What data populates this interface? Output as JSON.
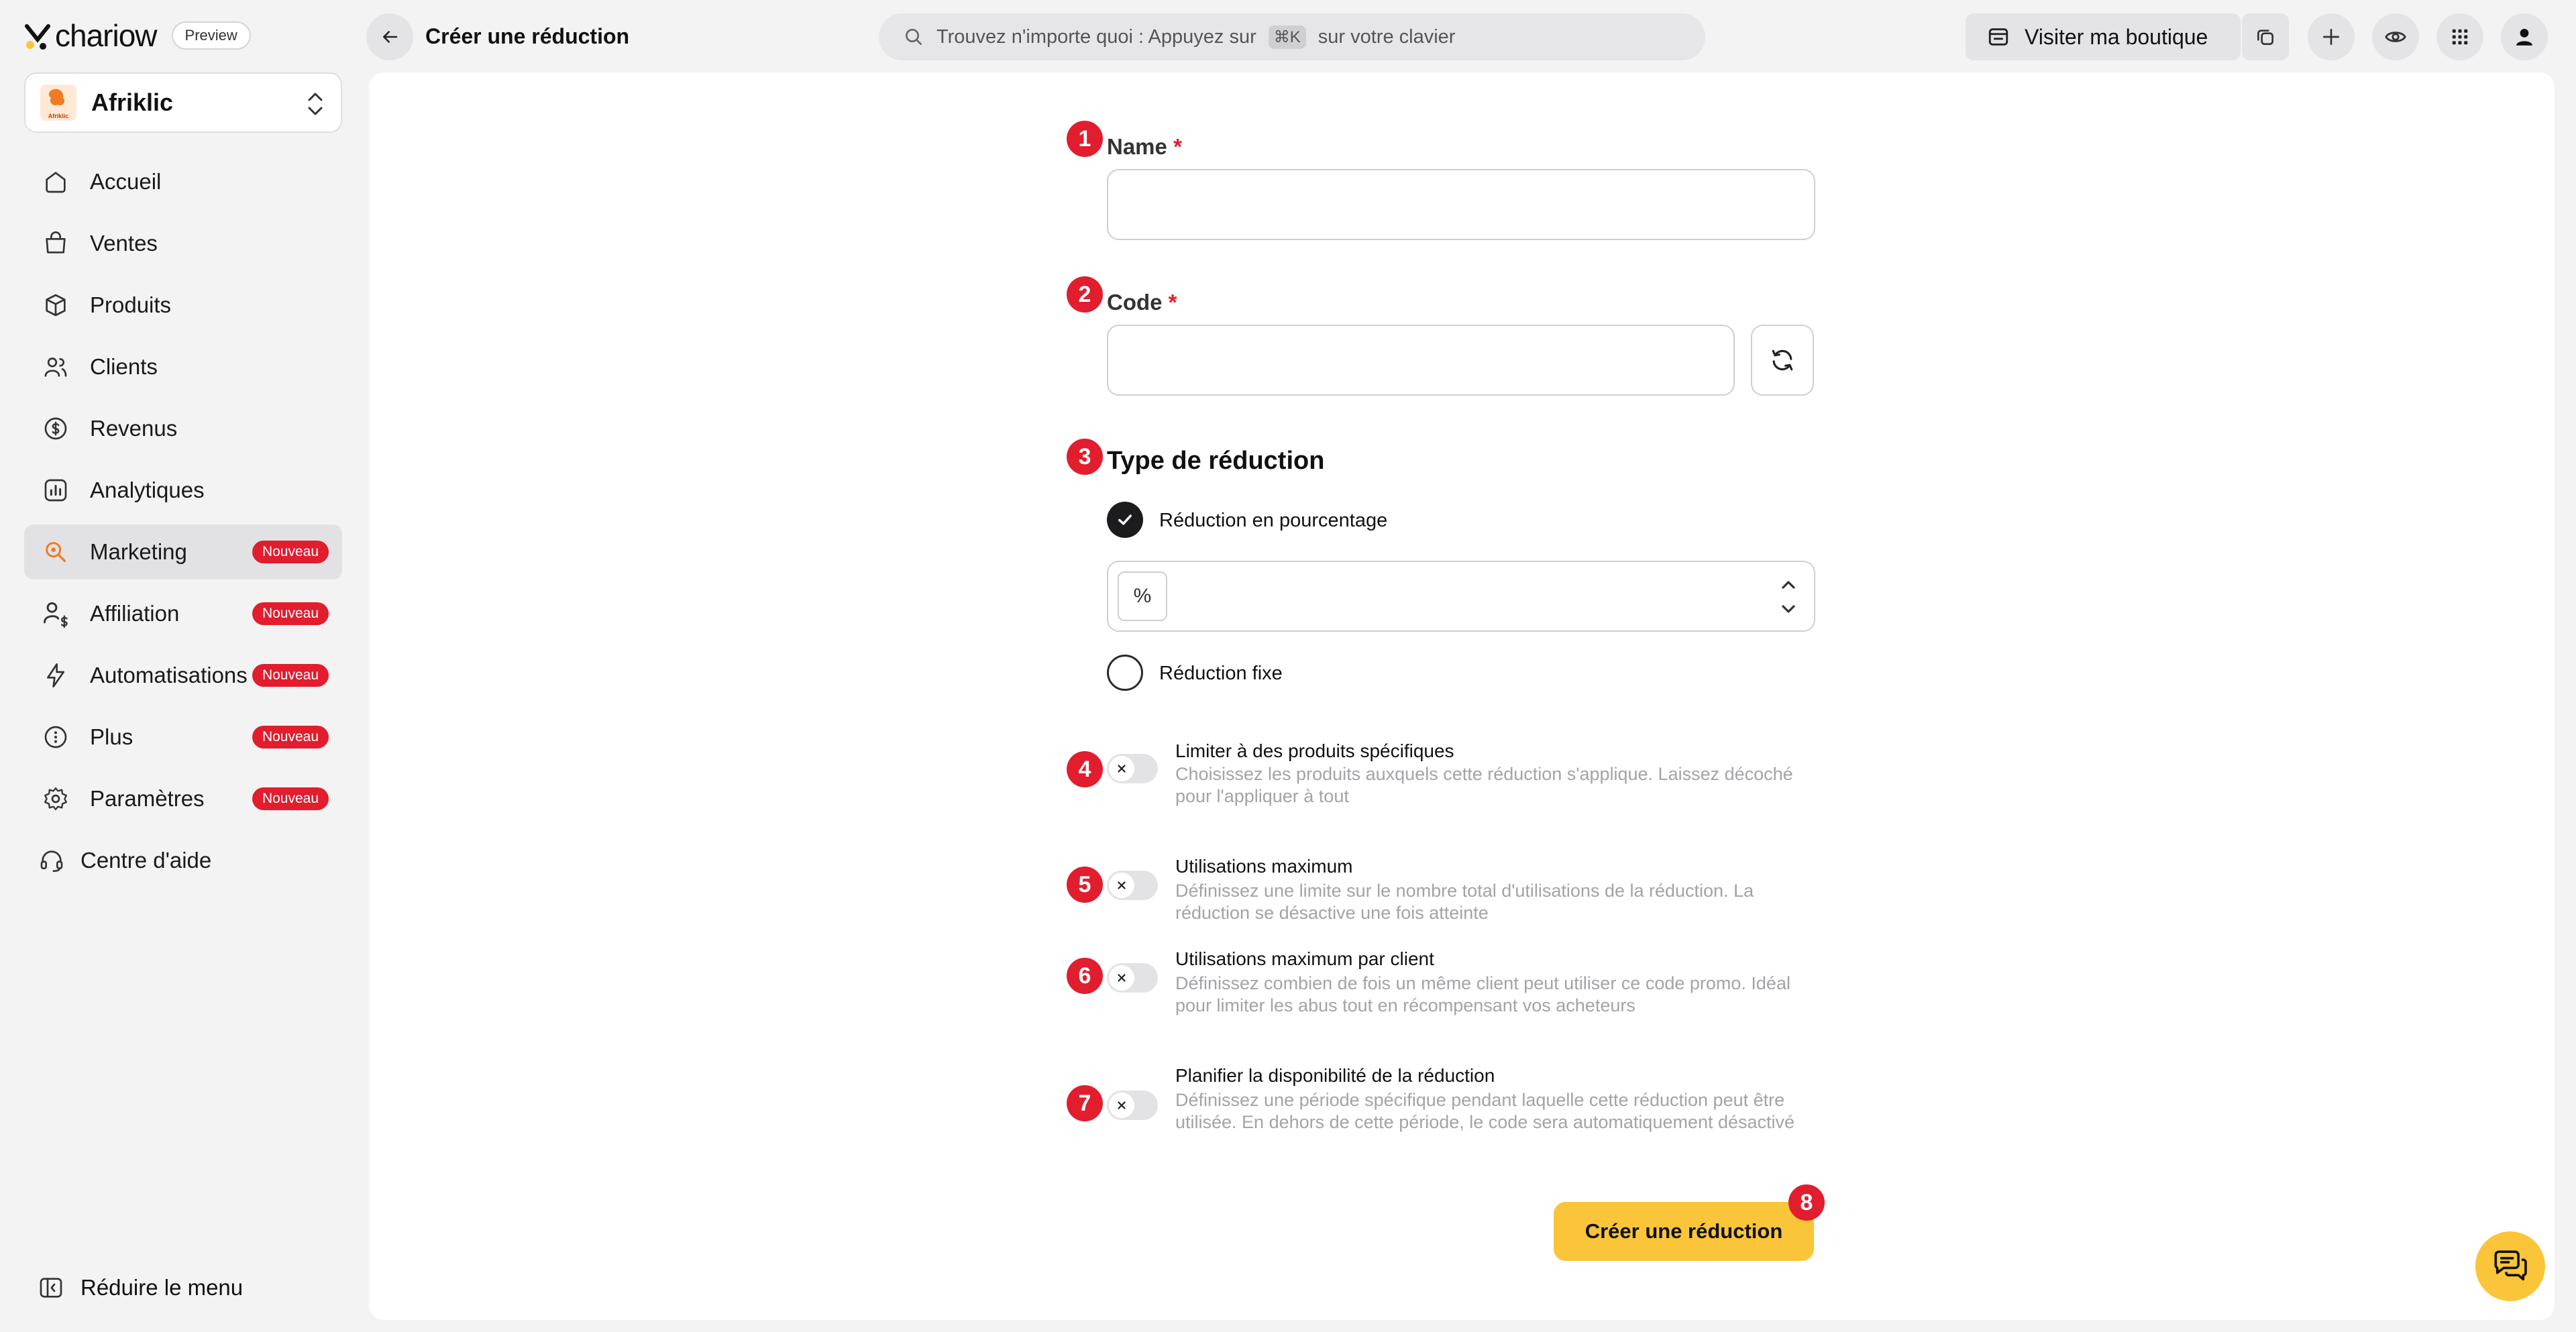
{
  "brand": {
    "logo_text": "chariow",
    "preview_badge": "Preview"
  },
  "header": {
    "title": "Créer une réduction",
    "search_prefix": "Trouvez n'importe quoi : Appuyez sur",
    "search_shortcut": "⌘K",
    "search_suffix": "sur votre clavier",
    "visit_label": "Visiter ma boutique"
  },
  "store": {
    "name": "Afriklic",
    "avatar_text": "Afriklic"
  },
  "sidebar": {
    "items": [
      {
        "label": "Accueil",
        "icon": "home-icon"
      },
      {
        "label": "Ventes",
        "icon": "shopping-bag-icon"
      },
      {
        "label": "Produits",
        "icon": "box-icon"
      },
      {
        "label": "Clients",
        "icon": "users-icon"
      },
      {
        "label": "Revenus",
        "icon": "dollar-circle-icon"
      },
      {
        "label": "Analytiques",
        "icon": "chart-icon"
      },
      {
        "label": "Marketing",
        "icon": "marketing-icon",
        "badge": "Nouveau",
        "active": true
      },
      {
        "label": "Affiliation",
        "icon": "affiliate-icon",
        "badge": "Nouveau"
      },
      {
        "label": "Automatisations",
        "icon": "bolt-icon",
        "badge": "Nouveau"
      },
      {
        "label": "Plus",
        "icon": "more-icon",
        "badge": "Nouveau"
      },
      {
        "label": "Paramètres",
        "icon": "gear-icon",
        "badge": "Nouveau"
      }
    ],
    "help_label": "Centre d'aide",
    "collapse_label": "Réduire le menu"
  },
  "form": {
    "name": {
      "number": "1",
      "label": "Name",
      "required_mark": "*",
      "value": ""
    },
    "code": {
      "number": "2",
      "label": "Code",
      "required_mark": "*",
      "value": ""
    },
    "type": {
      "number": "3",
      "title": "Type de réduction",
      "options": [
        {
          "label": "Réduction en pourcentage",
          "selected": true
        },
        {
          "label": "Réduction fixe",
          "selected": false
        }
      ],
      "percent_symbol": "%",
      "percent_value": ""
    },
    "toggles": [
      {
        "number": "4",
        "title": "Limiter à des produits spécifiques",
        "desc": "Choisissez les produits auxquels cette réduction s'applique. Laissez décoché pour l'appliquer à tout",
        "on": false
      },
      {
        "number": "5",
        "title": "Utilisations maximum",
        "desc": "Définissez une limite sur le nombre total d'utilisations de la réduction. La réduction se désactive une fois atteinte",
        "on": false
      },
      {
        "number": "6",
        "title": "Utilisations maximum par client",
        "desc": "Définissez combien de fois un même client peut utiliser ce code promo. Idéal pour limiter les abus tout en récompensant vos acheteurs",
        "on": false
      },
      {
        "number": "7",
        "title": "Planifier la disponibilité de la réduction",
        "desc": "Définissez une période spécifique pendant laquelle cette réduction peut être utilisée. En dehors de cette période, le code sera automatiquement désactivé",
        "on": false
      }
    ],
    "submit": {
      "number": "8",
      "label": "Créer une réduction"
    }
  },
  "colors": {
    "accent": "#fbc53a",
    "marker": "#e11d2e",
    "badge": "#e11d2e"
  }
}
